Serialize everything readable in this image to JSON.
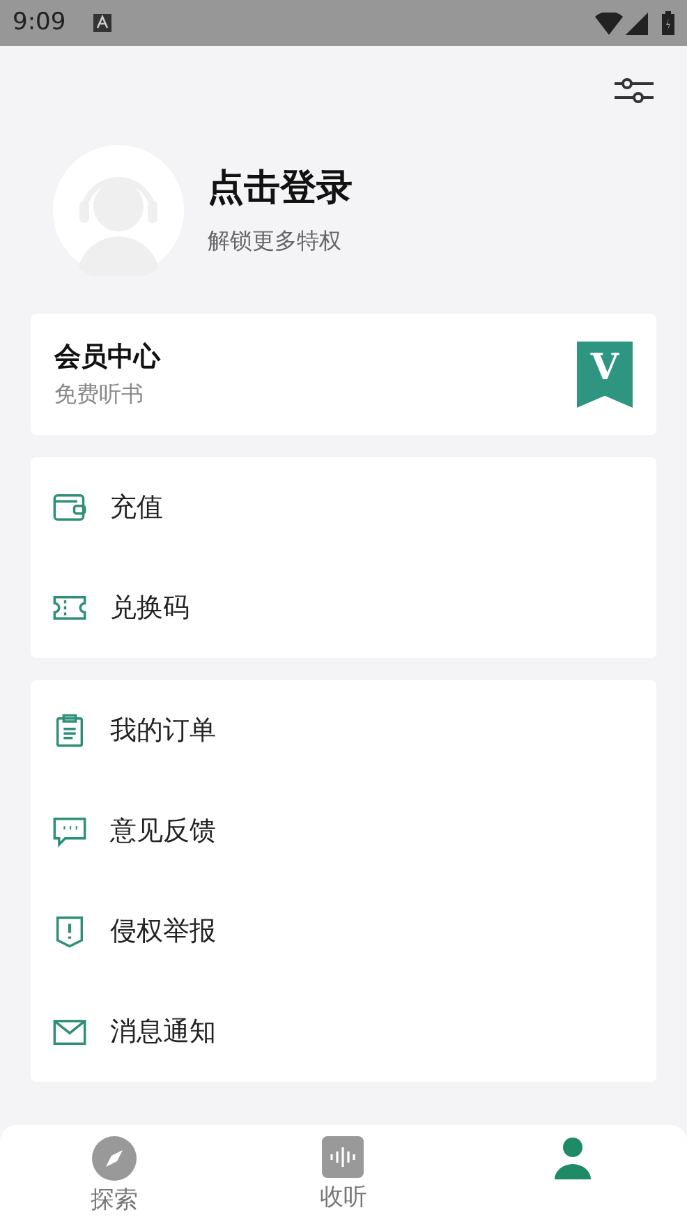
{
  "status_bar": {
    "time": "9:09"
  },
  "profile": {
    "title": "点击登录",
    "subtitle": "解锁更多特权"
  },
  "member_card": {
    "title": "会员中心",
    "subtitle": "免费听书",
    "badge": "V"
  },
  "wallet_menu": [
    {
      "kind": "wallet",
      "label": "充值"
    },
    {
      "kind": "ticket",
      "label": "兑换码"
    }
  ],
  "service_menu": [
    {
      "kind": "orders",
      "label": "我的订单"
    },
    {
      "kind": "feedback",
      "label": "意见反馈"
    },
    {
      "kind": "report",
      "label": "侵权举报"
    },
    {
      "kind": "mail",
      "label": "消息通知"
    }
  ],
  "bottom_nav": [
    {
      "kind": "explore",
      "label": "探索",
      "selected": false
    },
    {
      "kind": "listen",
      "label": "收听",
      "selected": false
    },
    {
      "kind": "me",
      "selected": true
    }
  ]
}
